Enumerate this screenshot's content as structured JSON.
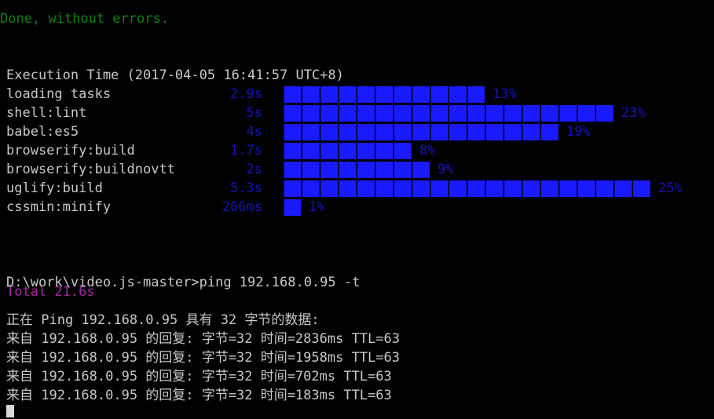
{
  "terminal": {
    "background_color": "#000000",
    "foreground_color": "#c8c8c8",
    "cursor": "block-cursor"
  },
  "build_result": {
    "status_line": "Done, without errors.",
    "status_color": "#108010"
  },
  "execution_time": {
    "header": "Execution Time (2017-04-05 16:41:57 UTC+8)",
    "total_label": "Total 21.6s",
    "total_color": "#a32aa3",
    "bar_color": "#1a1aff",
    "value_color": "#1414b4",
    "tasks": [
      {
        "name": "loading tasks",
        "time": "2.9s",
        "percent": "13%",
        "percent_value": 13,
        "blocks": 11
      },
      {
        "name": "shell:lint",
        "time": "5s",
        "percent": "23%",
        "percent_value": 23,
        "blocks": 18
      },
      {
        "name": "babel:es5",
        "time": "4s",
        "percent": "19%",
        "percent_value": 19,
        "blocks": 15
      },
      {
        "name": "browserify:build",
        "time": "1.7s",
        "percent": "8%",
        "percent_value": 8,
        "blocks": 7
      },
      {
        "name": "browserify:buildnovtt",
        "time": "2s",
        "percent": "9%",
        "percent_value": 9,
        "blocks": 8
      },
      {
        "name": "uglify:build",
        "time": "5.3s",
        "percent": "25%",
        "percent_value": 25,
        "blocks": 20
      },
      {
        "name": "cssmin:minify",
        "time": "266ms",
        "percent": "1%",
        "percent_value": 1,
        "blocks": 1
      }
    ]
  },
  "console": {
    "prompt_line": "D:\\work\\video.js-master>ping 192.168.0.95 -t",
    "blank_line": "",
    "ping_intro": "正在 Ping 192.168.0.95 具有 32 字节的数据:",
    "replies": [
      "来自 192.168.0.95 的回复: 字节=32 时间=2836ms TTL=63",
      "来自 192.168.0.95 的回复: 字节=32 时间=1958ms TTL=63",
      "来自 192.168.0.95 的回复: 字节=32 时间=702ms TTL=63",
      "来自 192.168.0.95 的回复: 字节=32 时间=183ms TTL=63"
    ]
  }
}
